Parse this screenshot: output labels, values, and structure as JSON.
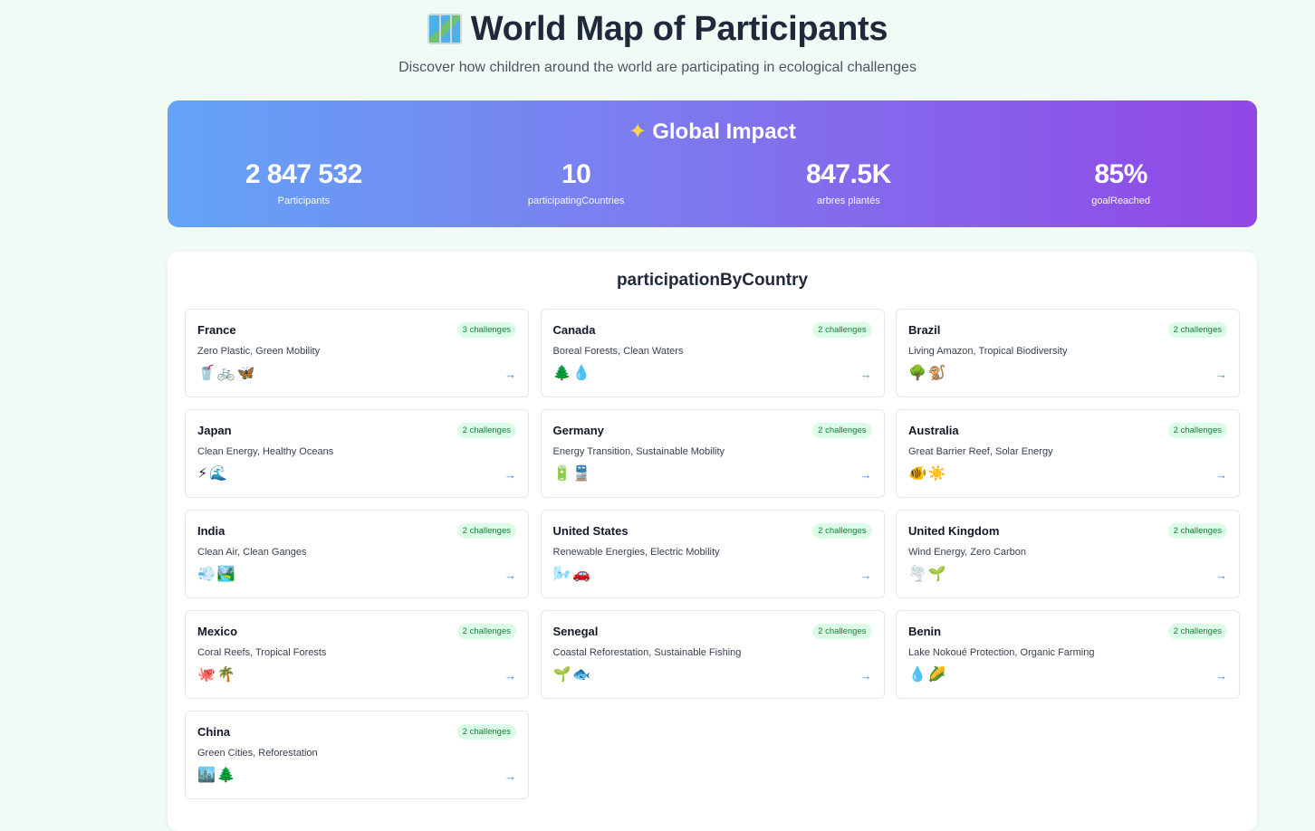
{
  "header": {
    "title": "World Map of Participants",
    "subtitle": "Discover how children around the world are participating in ecological challenges"
  },
  "impact": {
    "title": "Global Impact",
    "stats": [
      {
        "value": "2 847 532",
        "label": "Participants"
      },
      {
        "value": "10",
        "label": "participatingCountries"
      },
      {
        "value": "847.5K",
        "label": "arbres plantés"
      },
      {
        "value": "85%",
        "label": "goalReached"
      }
    ]
  },
  "panel": {
    "title": "participationByCountry",
    "countries": [
      {
        "name": "France",
        "badge": "3 challenges",
        "themes": "Zero Plastic, Green Mobility",
        "icons": "🥤🚲🦋"
      },
      {
        "name": "Canada",
        "badge": "2 challenges",
        "themes": "Boreal Forests, Clean Waters",
        "icons": "🌲💧"
      },
      {
        "name": "Brazil",
        "badge": "2 challenges",
        "themes": "Living Amazon, Tropical Biodiversity",
        "icons": "🌳🐒"
      },
      {
        "name": "Japan",
        "badge": "2 challenges",
        "themes": "Clean Energy, Healthy Oceans",
        "icons": "⚡🌊"
      },
      {
        "name": "Germany",
        "badge": "2 challenges",
        "themes": "Energy Transition, Sustainable Mobility",
        "icons": "🔋🚆"
      },
      {
        "name": "Australia",
        "badge": "2 challenges",
        "themes": "Great Barrier Reef, Solar Energy",
        "icons": "🐠☀️"
      },
      {
        "name": "India",
        "badge": "2 challenges",
        "themes": "Clean Air, Clean Ganges",
        "icons": "💨🏞️"
      },
      {
        "name": "United States",
        "badge": "2 challenges",
        "themes": "Renewable Energies, Electric Mobility",
        "icons": "🌬️🚗"
      },
      {
        "name": "United Kingdom",
        "badge": "2 challenges",
        "themes": "Wind Energy, Zero Carbon",
        "icons": "🌪️🌱"
      },
      {
        "name": "Mexico",
        "badge": "2 challenges",
        "themes": "Coral Reefs, Tropical Forests",
        "icons": "🐙🌴"
      },
      {
        "name": "Senegal",
        "badge": "2 challenges",
        "themes": "Coastal Reforestation, Sustainable Fishing",
        "icons": "🌱🐟"
      },
      {
        "name": "Benin",
        "badge": "2 challenges",
        "themes": "Lake Nokoué Protection, Organic Farming",
        "icons": "💧🌽"
      },
      {
        "name": "China",
        "badge": "2 challenges",
        "themes": "Green Cities, Reforestation",
        "icons": "🏙️🌲"
      }
    ]
  },
  "arrow_glyph": "→"
}
